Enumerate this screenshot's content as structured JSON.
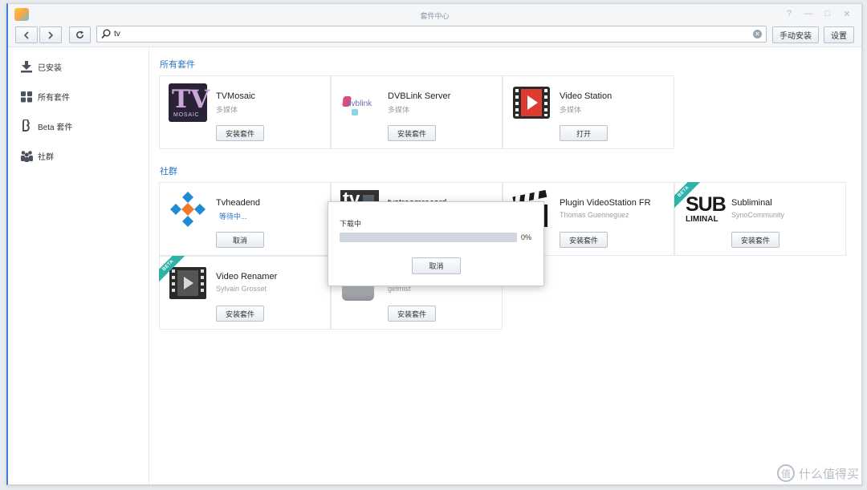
{
  "window": {
    "title": "套件中心",
    "controls": [
      "?",
      "—",
      "□",
      "✕"
    ]
  },
  "toolbar": {
    "back_icon": "chevron-left-icon",
    "forward_icon": "chevron-right-icon",
    "refresh_icon": "refresh-icon",
    "search_value": "tv",
    "manual_install_label": "手动安装",
    "settings_label": "设置"
  },
  "sidebar": {
    "items": [
      {
        "label": "已安装",
        "icon": "download-icon"
      },
      {
        "label": "所有套件",
        "icon": "grid-icon"
      },
      {
        "label": "Beta 套件",
        "icon": "beta-icon"
      },
      {
        "label": "社群",
        "icon": "community-icon"
      }
    ]
  },
  "sections": {
    "all_packages": {
      "title": "所有套件",
      "cards": [
        {
          "name": "TVMosaic",
          "sub": "多媒体",
          "button": "安装套件"
        },
        {
          "name": "DVBLink Server",
          "sub": "多媒体",
          "button": "安装套件"
        },
        {
          "name": "Video Station",
          "sub": "多媒体",
          "button": "打开"
        }
      ]
    },
    "community": {
      "title": "社群",
      "cards": [
        {
          "name": "Tvheadend",
          "sub": "等待中...",
          "button": "取消"
        },
        {
          "name": "tvstreamrecord",
          "sub": "",
          "button": ""
        },
        {
          "name": "Plugin VideoStation FR",
          "sub": "Thomas Guenneguez",
          "button": "安装套件"
        },
        {
          "name": "Subliminal",
          "sub": "SynoCommunity",
          "button": "安装套件",
          "badge": "BETA"
        },
        {
          "name": "Video Renamer",
          "sub": "Sylvain Grosset",
          "button": "安装套件",
          "badge": "BETA"
        },
        {
          "name": "",
          "sub": "gelmist",
          "button": "安装套件"
        }
      ]
    }
  },
  "dialog": {
    "title": "下载中",
    "progress": 0,
    "progress_text": "0%",
    "cancel_label": "取消"
  },
  "logos": {
    "tvmosaic_text": "TV",
    "tvmosaic_sub": "MOSAIC",
    "dvblink_text": "dvblink",
    "tvstream_text": "tv",
    "subliminal_text_1": "SUB",
    "subliminal_text_2": "LIMINAL"
  },
  "watermark": {
    "text": "什么值得买",
    "icon": "值"
  },
  "colors": {
    "accent": "#2a78c9",
    "window_edge": "#3d7fd4",
    "beta_ribbon": "#2bb3a8",
    "progress_fill": "#3d8de0"
  }
}
